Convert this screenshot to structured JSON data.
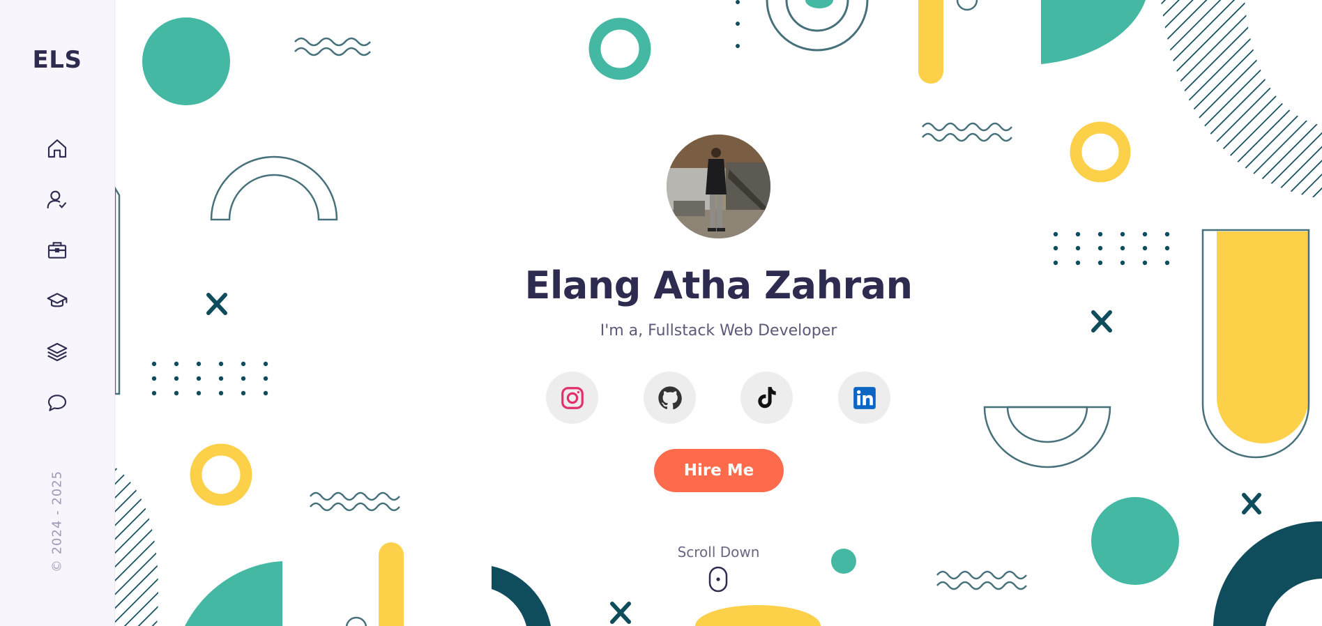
{
  "sidebar": {
    "logo": "ELS",
    "nav": [
      {
        "name": "home-icon"
      },
      {
        "name": "user-check-icon"
      },
      {
        "name": "briefcase-icon"
      },
      {
        "name": "graduation-cap-icon"
      },
      {
        "name": "layers-icon"
      },
      {
        "name": "chat-icon"
      }
    ],
    "copyright": "© 2024 - 2025"
  },
  "hero": {
    "name": "Elang Atha Zahran",
    "role": "I'm a, Fullstack Web Developer",
    "socials": [
      {
        "icon": "instagram-icon",
        "color": "#e1306c"
      },
      {
        "icon": "github-icon",
        "color": "#333333"
      },
      {
        "icon": "tiktok-icon",
        "color": "#111111"
      },
      {
        "icon": "linkedin-icon",
        "color": "#0a66c2"
      }
    ],
    "cta_label": "Hire Me",
    "scroll_label": "Scroll Down"
  },
  "colors": {
    "accent": "#fd6a4c",
    "teal": "#45b8a4",
    "yellow": "#fdd04a",
    "navy": "#2d2b4f",
    "dark_teal": "#0f4c5c"
  }
}
